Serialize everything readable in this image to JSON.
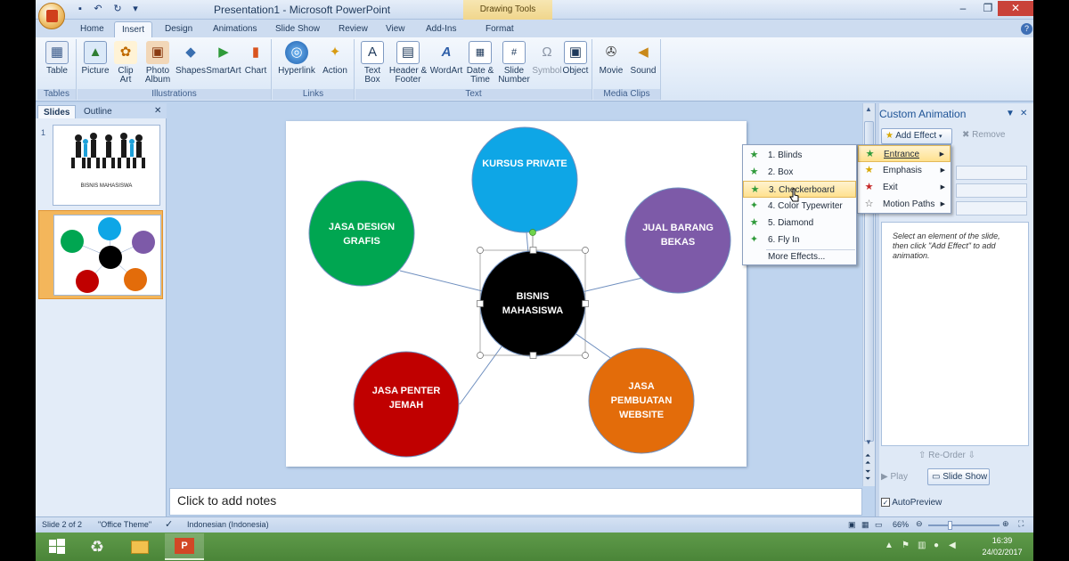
{
  "window": {
    "title": "Presentation1 - Microsoft PowerPoint",
    "contextual_tab_group": "Drawing Tools"
  },
  "tabs": [
    "Home",
    "Insert",
    "Design",
    "Animations",
    "Slide Show",
    "Review",
    "View",
    "Add-Ins",
    "Format"
  ],
  "active_tab": "Insert",
  "ribbon": {
    "groups": [
      {
        "label": "Tables",
        "buttons": [
          {
            "label": "Table",
            "icon": "table-icon"
          }
        ]
      },
      {
        "label": "Illustrations",
        "buttons": [
          {
            "label": "Picture",
            "icon": "picture-icon"
          },
          {
            "label": "Clip Art",
            "icon": "clip-art-icon"
          },
          {
            "label": "Photo Album",
            "icon": "photo-album-icon"
          },
          {
            "label": "Shapes",
            "icon": "shapes-icon"
          },
          {
            "label": "SmartArt",
            "icon": "smartart-icon"
          },
          {
            "label": "Chart",
            "icon": "chart-icon"
          }
        ]
      },
      {
        "label": "Links",
        "buttons": [
          {
            "label": "Hyperlink",
            "icon": "hyperlink-icon"
          },
          {
            "label": "Action",
            "icon": "action-icon"
          }
        ]
      },
      {
        "label": "Text",
        "buttons": [
          {
            "label": "Text Box",
            "icon": "text-box-icon"
          },
          {
            "label": "Header & Footer",
            "icon": "header-footer-icon"
          },
          {
            "label": "WordArt",
            "icon": "wordart-icon"
          },
          {
            "label": "Date & Time",
            "icon": "date-time-icon"
          },
          {
            "label": "Slide Number",
            "icon": "slide-number-icon"
          },
          {
            "label": "Symbol",
            "icon": "symbol-icon"
          },
          {
            "label": "Object",
            "icon": "object-icon"
          }
        ]
      },
      {
        "label": "Media Clips",
        "buttons": [
          {
            "label": "Movie",
            "icon": "movie-icon"
          },
          {
            "label": "Sound",
            "icon": "sound-icon"
          }
        ]
      }
    ]
  },
  "slides_pane": {
    "tabs": [
      "Slides",
      "Outline"
    ],
    "slides": [
      {
        "number": "1",
        "caption": "BISNIS MAHASISWA"
      },
      {
        "number": "2"
      }
    ]
  },
  "slide": {
    "center": "BISNIS MAHASISWA",
    "nodes": [
      {
        "label": "KURSUS PRIVATE",
        "color": "#0ea6e6"
      },
      {
        "label": "JUAL BARANG BEKAS",
        "color": "#7d5aa8"
      },
      {
        "label": "JASA PEMBUATAN WEBSITE",
        "color": "#e36c0a"
      },
      {
        "label": "JASA PENTERJEMAH",
        "color": "#c00000"
      },
      {
        "label": "JASA DESIGN GRAFIS",
        "color": "#00a651"
      }
    ]
  },
  "notes_placeholder": "Click to add notes",
  "custom_animation": {
    "title": "Custom Animation",
    "add_effect": "Add Effect",
    "remove": "Remove",
    "hint": "Select an element of the slide, then click \"Add Effect\" to add animation.",
    "reorder": "Re-Order",
    "play": "Play",
    "slide_show": "Slide Show",
    "autopreview": "AutoPreview"
  },
  "add_effect_menu": [
    {
      "label": "Entrance",
      "highlighted": true
    },
    {
      "label": "Emphasis"
    },
    {
      "label": "Exit"
    },
    {
      "label": "Motion Paths"
    }
  ],
  "entrance_menu": [
    {
      "label": "1. Blinds"
    },
    {
      "label": "2. Box"
    },
    {
      "label": "3. Checkerboard",
      "highlighted": true
    },
    {
      "label": "4. Color Typewriter"
    },
    {
      "label": "5. Diamond"
    },
    {
      "label": "6. Fly In"
    },
    {
      "label": "More Effects..."
    }
  ],
  "status": {
    "slide": "Slide 2 of 2",
    "theme": "\"Office Theme\"",
    "language": "Indonesian (Indonesia)",
    "zoom": "66%"
  },
  "taskbar": {
    "time": "16:39",
    "date": "24/02/2017"
  }
}
